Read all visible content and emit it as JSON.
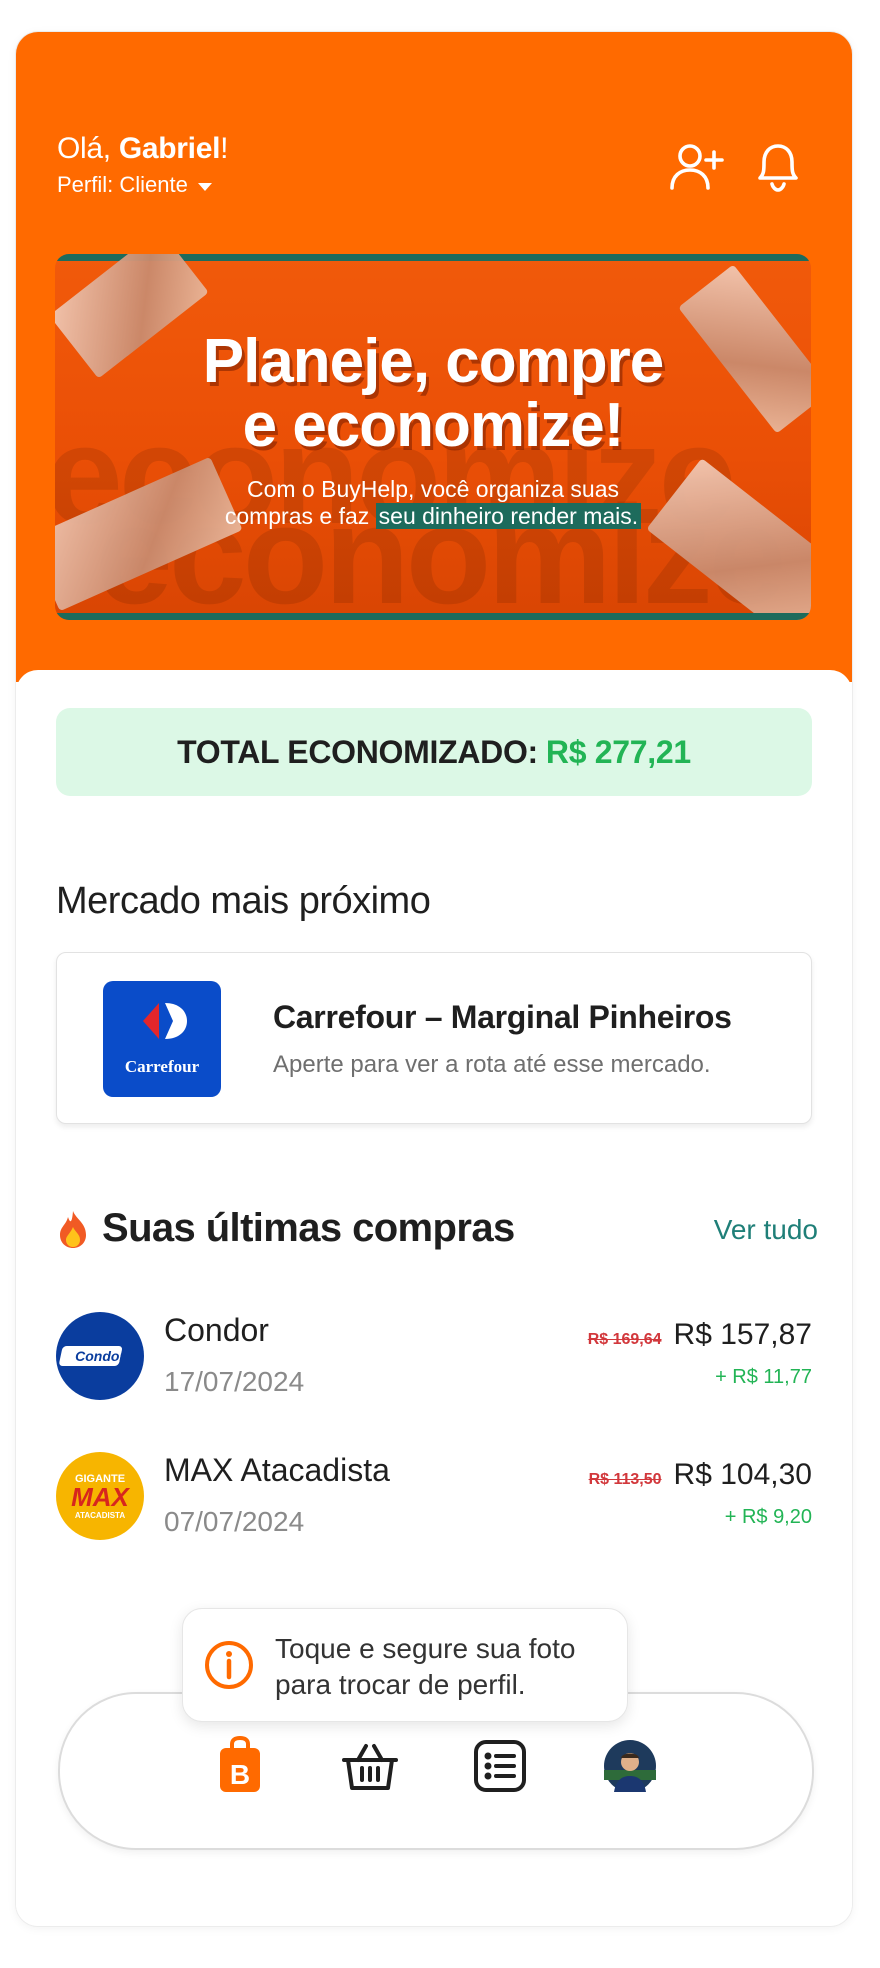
{
  "header": {
    "greeting_prefix": "Olá, ",
    "user_name": "Gabriel",
    "greeting_suffix": "!",
    "profile_label": "Perfil: Cliente"
  },
  "banner": {
    "headline_line1": "Planeje, compre",
    "headline_line2": "e economize!",
    "sub_line1": "Com o BuyHelp, você organiza suas",
    "sub_line2_prefix": "compras e faz ",
    "sub_line2_highlight": "seu dinheiro render mais.",
    "ghost_text": "economize"
  },
  "savings": {
    "label": "TOTAL ECONOMIZADO:",
    "value": "R$ 277,21"
  },
  "nearest_market": {
    "title": "Mercado mais próximo",
    "name": "Carrefour – Marginal Pinheiros",
    "description": "Aperte para ver a rota até esse mercado.",
    "logo_text": "Carrefour"
  },
  "recent": {
    "title": "Suas últimas compras",
    "see_all": "Ver tudo",
    "items": [
      {
        "store": "Condor",
        "date": "17/07/2024",
        "old_price": "R$ 169,64",
        "price": "R$ 157,87",
        "saving": "+ R$ 11,77",
        "logo_text": "Condor"
      },
      {
        "store": "MAX Atacadista",
        "date": "07/07/2024",
        "old_price": "R$ 113,50",
        "price": "R$ 104,30",
        "saving": "+ R$ 9,20",
        "logo_top": "GIGANTE",
        "logo_mid": "MAX",
        "logo_bot": "ATACADISTA"
      }
    ]
  },
  "tooltip": {
    "line1": "Toque e segure sua foto",
    "line2": "para trocar de perfil."
  },
  "colors": {
    "brand_orange": "#ff6a00",
    "savings_green": "#22b455",
    "link_teal": "#1f7f78",
    "banner_teal": "#1d6b5c"
  },
  "nav": {
    "items": [
      "home-bag-icon",
      "basket-icon",
      "list-icon",
      "profile-avatar"
    ]
  }
}
